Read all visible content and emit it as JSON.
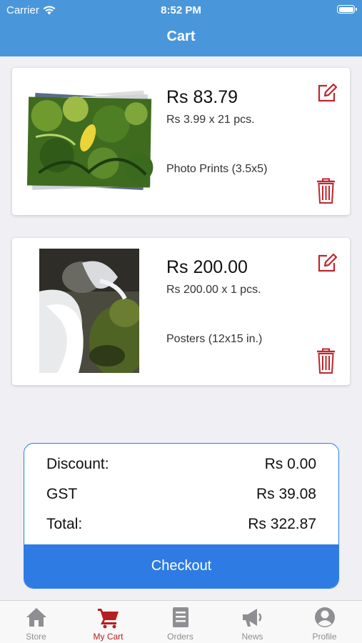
{
  "status_bar": {
    "carrier": "Carrier",
    "time": "8:52 PM"
  },
  "nav": {
    "title": "Cart"
  },
  "cart_items": [
    {
      "price": "Rs 83.79",
      "unit_line": "Rs 3.99 x 21 pcs.",
      "product": "Photo Prints (3.5x5)"
    },
    {
      "price": "Rs 200.00",
      "unit_line": "Rs 200.00 x 1 pcs.",
      "product": "Posters (12x15 in.)"
    }
  ],
  "summary": {
    "discount_label": "Discount:",
    "discount_value": "Rs 0.00",
    "gst_label": "GST",
    "gst_value": "Rs 39.08",
    "total_label": "Total:",
    "total_value": "Rs 322.87",
    "checkout_label": "Checkout"
  },
  "tabs": [
    {
      "label": "Store",
      "icon": "home-icon"
    },
    {
      "label": "My Cart",
      "icon": "cart-icon",
      "active": true
    },
    {
      "label": "Orders",
      "icon": "orders-icon"
    },
    {
      "label": "News",
      "icon": "megaphone-icon"
    },
    {
      "label": "Profile",
      "icon": "profile-icon"
    }
  ],
  "colors": {
    "header": "#4a96da",
    "accent": "#2d7be3",
    "icon_red": "#c0262d",
    "active_tab": "#b51f1f",
    "inactive_tab": "#8e8e93"
  }
}
